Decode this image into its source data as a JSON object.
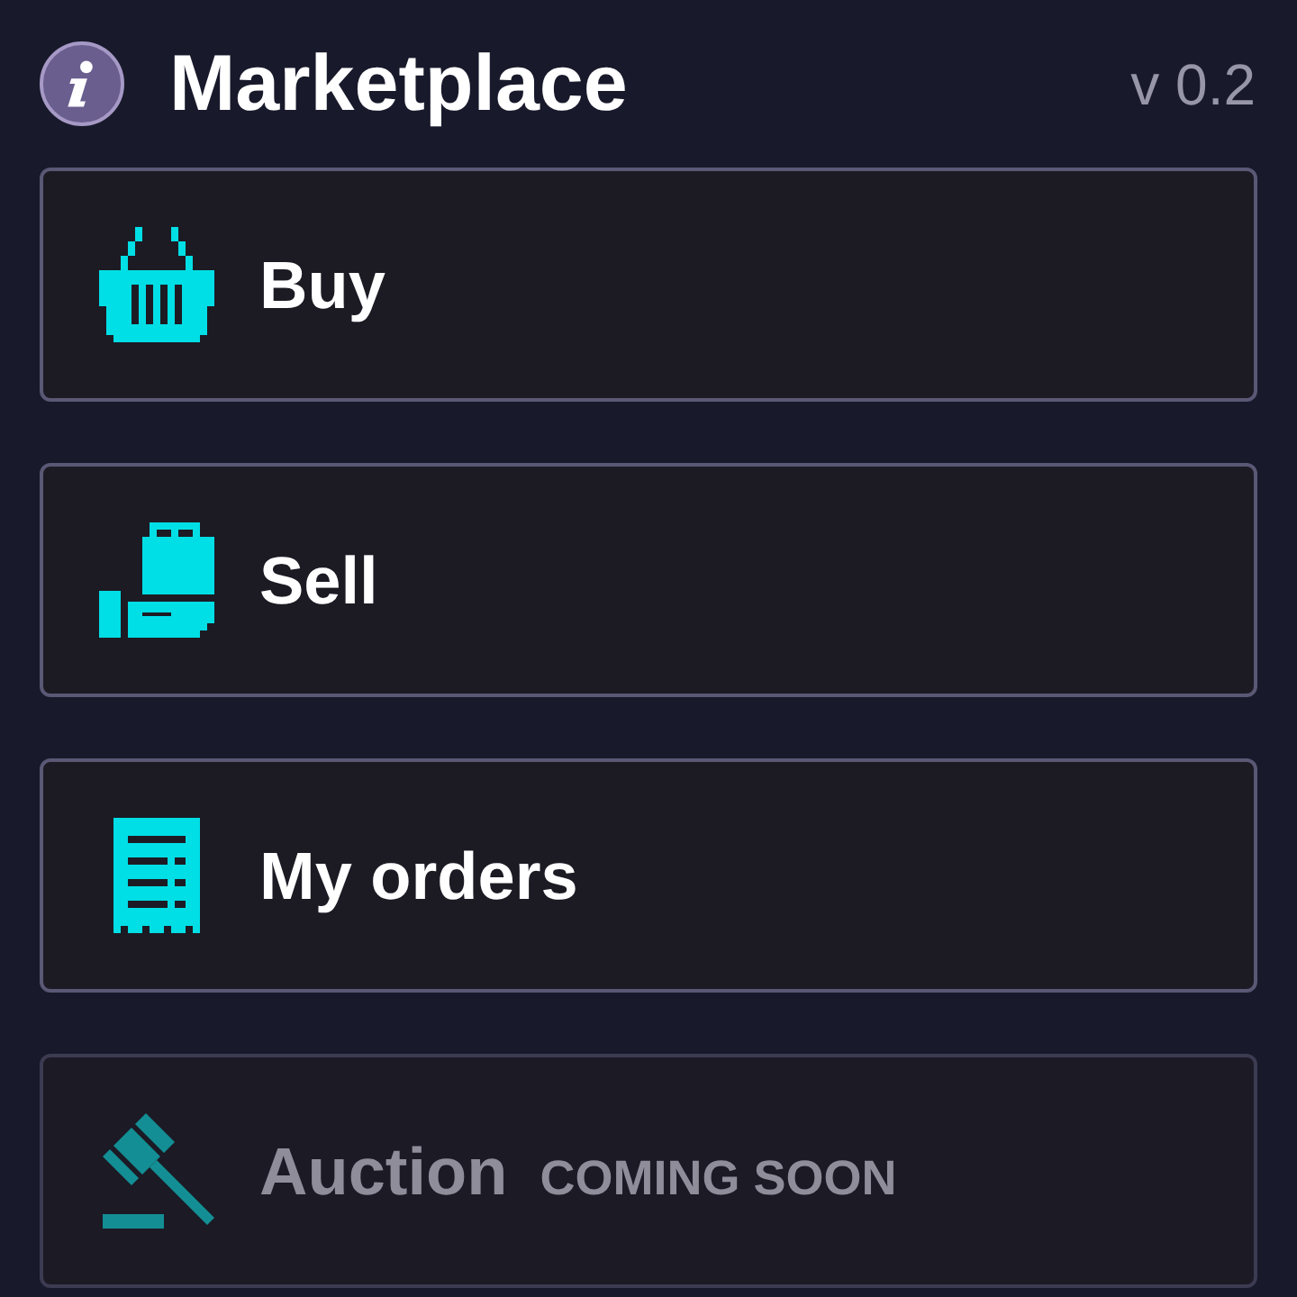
{
  "header": {
    "title": "Marketplace",
    "version": "v 0.2"
  },
  "menu": [
    {
      "label": "Buy",
      "disabled": false
    },
    {
      "label": "Sell",
      "disabled": false
    },
    {
      "label": "My orders",
      "disabled": false
    },
    {
      "label": "Auction",
      "disabled": true,
      "badge": "COMING SOON"
    }
  ]
}
